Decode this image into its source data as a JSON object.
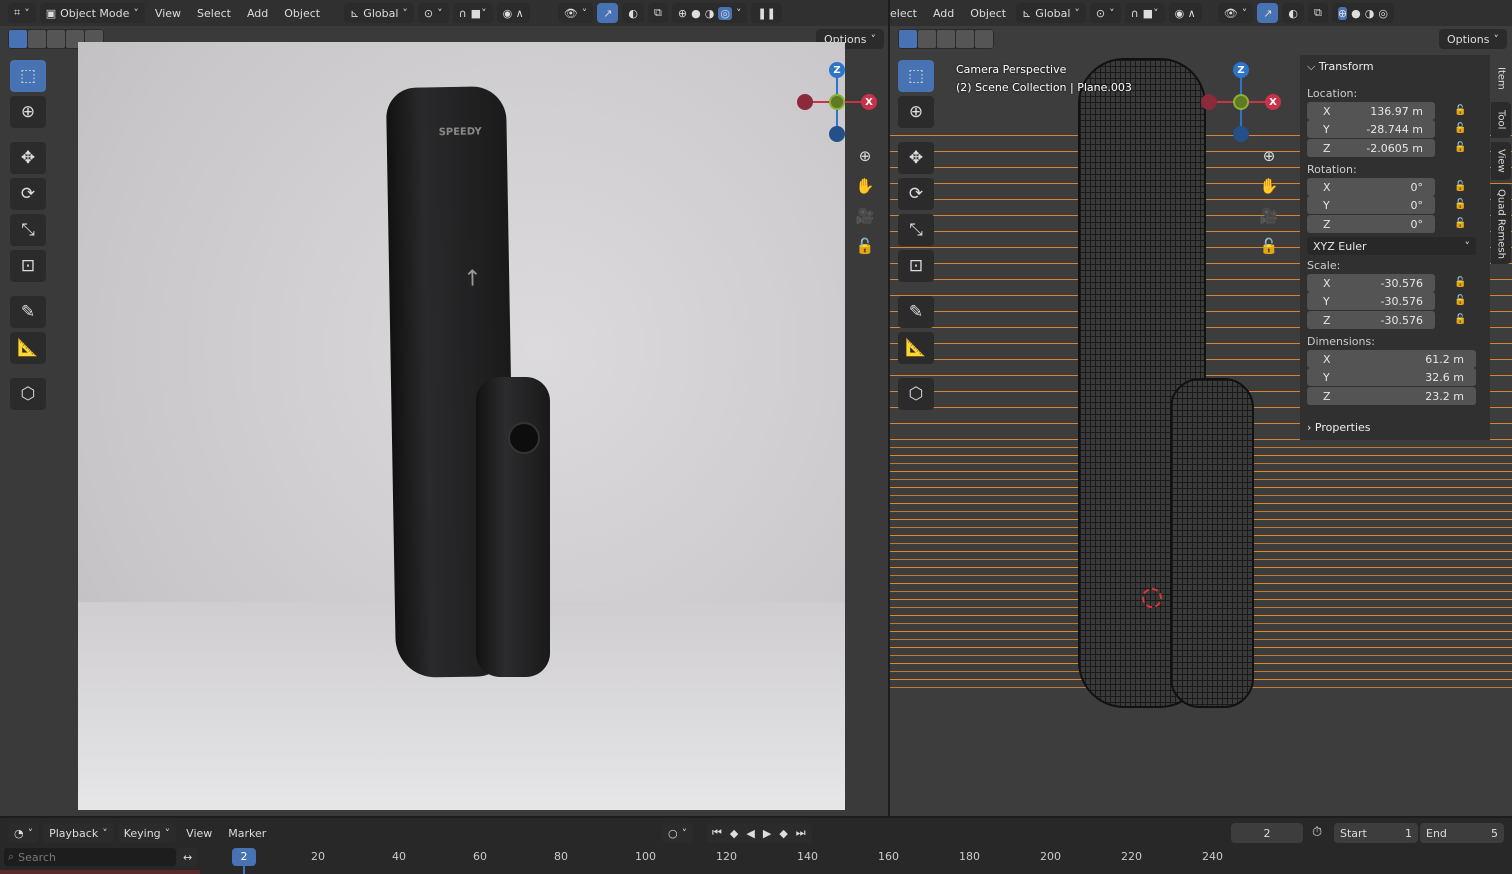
{
  "left_header": {
    "mode": "Object Mode",
    "menus": [
      "View",
      "Select",
      "Add",
      "Object"
    ],
    "orientation": "Global",
    "options": "Options"
  },
  "right_header": {
    "menus": [
      "elect",
      "Add",
      "Object"
    ],
    "orientation": "Global",
    "options": "Options"
  },
  "viewport_info": {
    "line1": "Camera Perspective",
    "line2": "(2) Scene Collection | Plane.003"
  },
  "gizmo": {
    "x": "X",
    "z": "Z"
  },
  "device_label": "SPEEDY",
  "npanel": {
    "title": "Transform",
    "location_label": "Location:",
    "location": [
      {
        "axis": "X",
        "value": "136.97 m"
      },
      {
        "axis": "Y",
        "value": "-28.744 m"
      },
      {
        "axis": "Z",
        "value": "-2.0605 m"
      }
    ],
    "rotation_label": "Rotation:",
    "rotation": [
      {
        "axis": "X",
        "value": "0°"
      },
      {
        "axis": "Y",
        "value": "0°"
      },
      {
        "axis": "Z",
        "value": "0°"
      }
    ],
    "rotation_mode": "XYZ Euler",
    "scale_label": "Scale:",
    "scale": [
      {
        "axis": "X",
        "value": "-30.576"
      },
      {
        "axis": "Y",
        "value": "-30.576"
      },
      {
        "axis": "Z",
        "value": "-30.576"
      }
    ],
    "dimensions_label": "Dimensions:",
    "dimensions": [
      {
        "axis": "X",
        "value": "61.2 m"
      },
      {
        "axis": "Y",
        "value": "32.6 m"
      },
      {
        "axis": "Z",
        "value": "23.2 m"
      }
    ],
    "properties": "Properties"
  },
  "sidebar_tabs": [
    "Item",
    "Tool",
    "View",
    "Quad Remesh"
  ],
  "timeline": {
    "menus": [
      "Playback",
      "Keying",
      "View",
      "Marker"
    ],
    "current_frame": "2",
    "start_label": "Start",
    "start": "1",
    "end_label": "End",
    "end": "5",
    "search_placeholder": "Search",
    "ticks": [
      "20",
      "40",
      "60",
      "80",
      "100",
      "120",
      "140",
      "160",
      "180",
      "200",
      "220",
      "240"
    ]
  },
  "colors": {
    "accent": "#4772b3",
    "x_axis": "#c8334a",
    "y_axis": "#8bb032",
    "z_axis": "#2d75c8",
    "wire_lines": "#e08a2a"
  }
}
